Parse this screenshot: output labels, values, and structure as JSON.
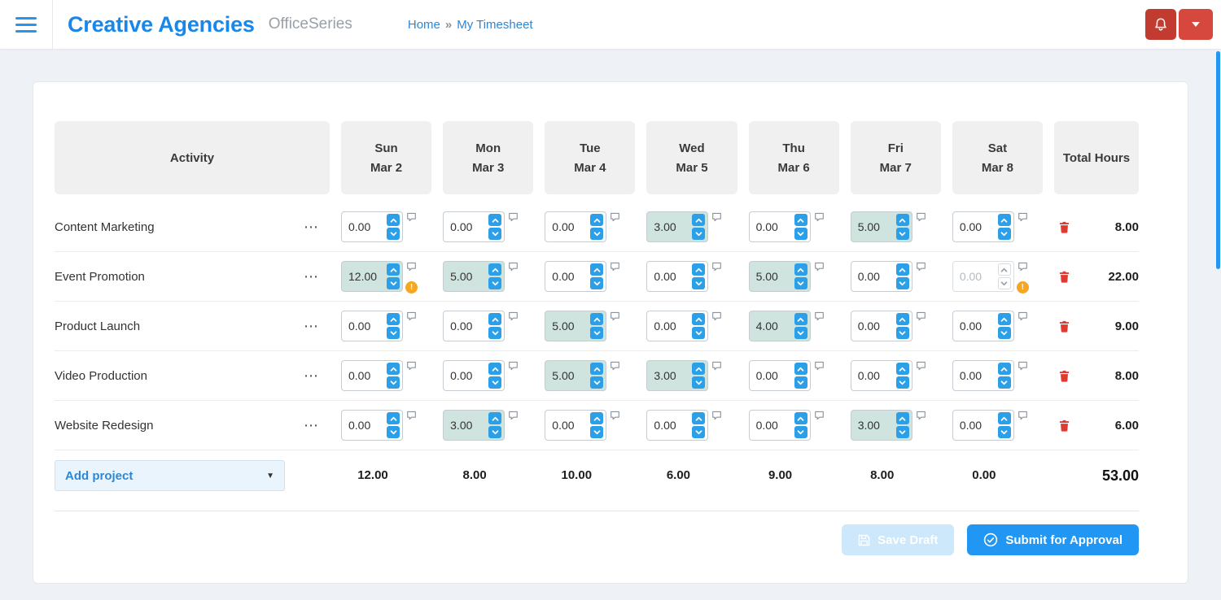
{
  "colors": {
    "accent": "#2196f3",
    "brand_blue": "#1787ea",
    "danger_red": "#df3a32",
    "warning_orange": "#f5a623",
    "cell_highlight": "#cfe3df"
  },
  "icons": {
    "menu": "hamburger-icon",
    "notifications": "bell-icon",
    "account": "caret-down-icon",
    "cell_note": "speech-bubble-icon",
    "delete_row": "trash-icon",
    "cell_warning": "exclamation-circle-icon",
    "save_draft": "floppy-disk-icon",
    "submit": "check-circle-icon"
  },
  "header": {
    "brand": "Creative Agencies",
    "product": "OfficeSeries",
    "breadcrumb": {
      "home": "Home",
      "separator": "»",
      "current": "My Timesheet"
    }
  },
  "table": {
    "columns": [
      {
        "label": "Activity"
      },
      {
        "day": "Sun",
        "date": "Mar 2"
      },
      {
        "day": "Mon",
        "date": "Mar 3"
      },
      {
        "day": "Tue",
        "date": "Mar 4"
      },
      {
        "day": "Wed",
        "date": "Mar 5"
      },
      {
        "day": "Thu",
        "date": "Mar 6"
      },
      {
        "day": "Fri",
        "date": "Mar 7"
      },
      {
        "day": "Sat",
        "date": "Mar 8"
      },
      {
        "label": "Total Hours"
      }
    ],
    "rows": [
      {
        "activity": "Content Marketing",
        "cells": [
          {
            "value": "0.00"
          },
          {
            "value": "0.00"
          },
          {
            "value": "0.00"
          },
          {
            "value": "3.00",
            "highlighted": true
          },
          {
            "value": "0.00"
          },
          {
            "value": "5.00",
            "highlighted": true
          },
          {
            "value": "0.00"
          }
        ],
        "total": "8.00"
      },
      {
        "activity": "Event Promotion",
        "cells": [
          {
            "value": "12.00",
            "highlighted": true,
            "warning": true
          },
          {
            "value": "5.00",
            "highlighted": true
          },
          {
            "value": "0.00"
          },
          {
            "value": "0.00"
          },
          {
            "value": "5.00",
            "highlighted": true
          },
          {
            "value": "0.00"
          },
          {
            "value": "0.00",
            "disabled": true,
            "warning": true
          }
        ],
        "total": "22.00"
      },
      {
        "activity": "Product Launch",
        "cells": [
          {
            "value": "0.00"
          },
          {
            "value": "0.00"
          },
          {
            "value": "5.00",
            "highlighted": true
          },
          {
            "value": "0.00"
          },
          {
            "value": "4.00",
            "highlighted": true
          },
          {
            "value": "0.00"
          },
          {
            "value": "0.00"
          }
        ],
        "total": "9.00"
      },
      {
        "activity": "Video Production",
        "cells": [
          {
            "value": "0.00"
          },
          {
            "value": "0.00"
          },
          {
            "value": "5.00",
            "highlighted": true
          },
          {
            "value": "3.00",
            "highlighted": true
          },
          {
            "value": "0.00"
          },
          {
            "value": "0.00"
          },
          {
            "value": "0.00"
          }
        ],
        "total": "8.00"
      },
      {
        "activity": "Website Redesign",
        "cells": [
          {
            "value": "0.00"
          },
          {
            "value": "3.00",
            "highlighted": true
          },
          {
            "value": "0.00"
          },
          {
            "value": "0.00"
          },
          {
            "value": "0.00"
          },
          {
            "value": "3.00",
            "highlighted": true
          },
          {
            "value": "0.00"
          }
        ],
        "total": "6.00"
      }
    ],
    "footer": {
      "add_project_label": "Add project",
      "day_totals": [
        "12.00",
        "8.00",
        "10.00",
        "6.00",
        "9.00",
        "8.00",
        "0.00"
      ],
      "grand_total": "53.00"
    }
  },
  "actions": {
    "save_draft_label": "Save Draft",
    "submit_label": "Submit for Approval"
  }
}
